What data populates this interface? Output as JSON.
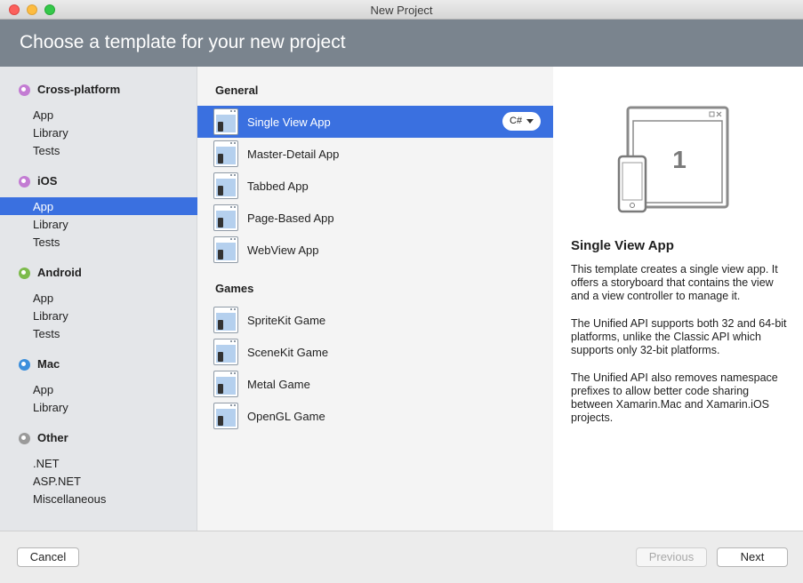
{
  "window": {
    "title": "New Project"
  },
  "header": {
    "title": "Choose a template for your new project"
  },
  "sidebar": {
    "categories": [
      {
        "label": "Cross-platform",
        "color": "#c37cd3",
        "items": [
          "App",
          "Library",
          "Tests"
        ]
      },
      {
        "label": "iOS",
        "color": "#c37cd3",
        "items": [
          "App",
          "Library",
          "Tests"
        ]
      },
      {
        "label": "Android",
        "color": "#7dbb4c",
        "items": [
          "App",
          "Library",
          "Tests"
        ]
      },
      {
        "label": "Mac",
        "color": "#3c8fdc",
        "items": [
          "App",
          "Library"
        ]
      },
      {
        "label": "Other",
        "color": "#9a9a9a",
        "items": [
          ".NET",
          "ASP.NET",
          "Miscellaneous"
        ]
      }
    ],
    "selected": "iOS / App"
  },
  "templates": {
    "groups": [
      {
        "label": "General",
        "items": [
          "Single View App",
          "Master-Detail App",
          "Tabbed App",
          "Page-Based App",
          "WebView App"
        ]
      },
      {
        "label": "Games",
        "items": [
          "SpriteKit Game",
          "SceneKit Game",
          "Metal Game",
          "OpenGL Game"
        ]
      }
    ],
    "selected": "Single View App",
    "language": "C#"
  },
  "detail": {
    "preview_number": "1",
    "title": "Single View App",
    "paragraphs": [
      "This template creates a single view app. It offers a storyboard that contains the view and a view controller to manage it.",
      "The Unified API supports both 32 and 64-bit platforms, unlike the Classic API which supports only 32-bit platforms.",
      "The Unified API also removes namespace prefixes to allow better code sharing between Xamarin.Mac and Xamarin.iOS projects."
    ]
  },
  "footer": {
    "cancel": "Cancel",
    "previous": "Previous",
    "next": "Next"
  },
  "colors": {
    "accent": "#3a70e0",
    "header": "#7a848e"
  }
}
